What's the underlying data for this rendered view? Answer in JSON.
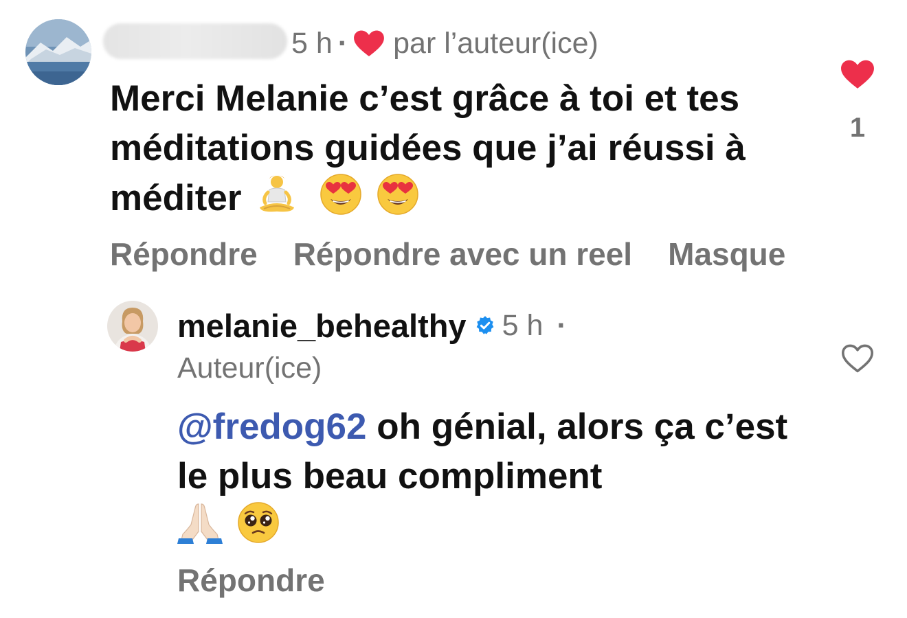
{
  "comment": {
    "time": "5 h",
    "separator": "·",
    "liked_by": "par l’auteur(ice)",
    "text": "Merci Melanie c’est grâce à toi et tes méditations guidées que j’ai réussi à méditer",
    "emojis": [
      "person-meditating",
      "smiling-face-heart-eyes",
      "smiling-face-heart-eyes"
    ],
    "like_count": "1",
    "actions": {
      "reply": "Répondre",
      "reply_reel": "Répondre avec un reel",
      "hide": "Masque"
    },
    "colors": {
      "like": "#ed2f4b",
      "muted": "#737373"
    }
  },
  "reply": {
    "username": "melanie_behealthy",
    "verified": true,
    "time": "5 h",
    "separator": "·",
    "role": "Auteur(ice)",
    "mention": "@fredog62",
    "text": " oh génial, alors ça c’est le plus beau compliment",
    "emojis": [
      "folded-hands",
      "pleading-face"
    ],
    "actions": {
      "reply": "Répondre"
    },
    "colors": {
      "mention": "#3d5ab0",
      "verified": "#1c8ff0"
    }
  }
}
